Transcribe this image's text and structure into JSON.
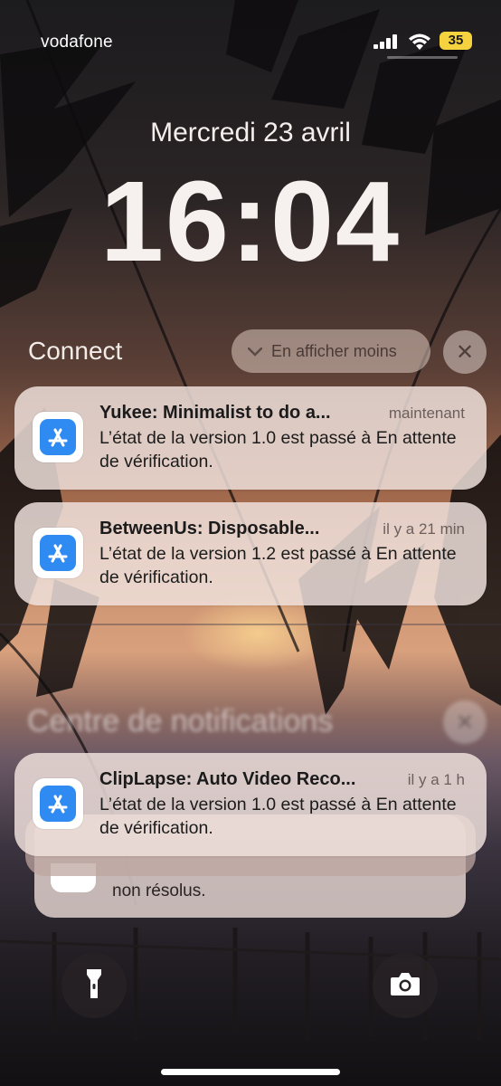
{
  "status_bar": {
    "carrier": "vodafone",
    "battery": "35",
    "signal_icon": "cellular-signal-icon",
    "wifi_icon": "wifi-icon"
  },
  "lock_screen": {
    "date": "Mercredi 23 avril",
    "time": "16:04"
  },
  "group": {
    "title": "Connect",
    "collapse_label": "En afficher moins",
    "close_glyph": "✕"
  },
  "notifications": [
    {
      "app_icon": "app-store-icon",
      "title": "Yukee: Minimalist to do a...",
      "time": "maintenant",
      "body": "L’état de la version 1.0 est passé à En attente de vérification."
    },
    {
      "app_icon": "app-store-icon",
      "title": "BetweenUs: Disposable...",
      "time": "il y a 21 min",
      "body": "L’état de la version 1.2 est passé à En attente de vérification."
    }
  ],
  "notification_center": {
    "title": "Centre de notifications",
    "close_glyph": "✕",
    "stack_top": {
      "app_icon": "app-store-icon",
      "title": "ClipLapse: Auto Video Reco...",
      "time": "il y a 1 h",
      "body": "L’état de la version 1.0 est passé à En attente de vérification."
    },
    "stack_back_text": "non résolus."
  },
  "bottom_controls": {
    "flashlight_icon": "flashlight-icon",
    "camera_icon": "camera-icon"
  }
}
